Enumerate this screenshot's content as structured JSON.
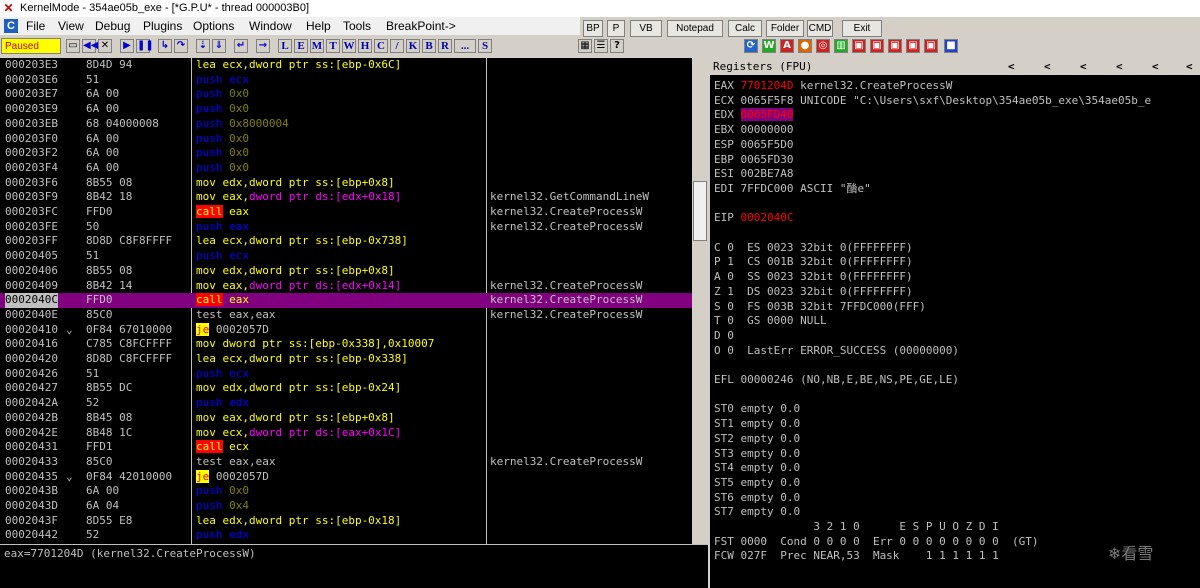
{
  "window": {
    "title": "KernelMode - 354ae05b_exe - [*G.P.U* - thread 000003B0]"
  },
  "menu": {
    "items": [
      "File",
      "View",
      "Debug",
      "Plugins",
      "Options",
      "Window",
      "Help",
      "Tools",
      "BreakPoint->"
    ]
  },
  "plugins": {
    "items": [
      "BP",
      "P",
      "VB",
      "Notepad",
      "Calc",
      "Folder",
      "CMD",
      "Exit"
    ]
  },
  "toolbar": {
    "status": "Paused",
    "letters": [
      "L",
      "E",
      "M",
      "T",
      "W",
      "H",
      "C",
      "/",
      "K",
      "B",
      "R",
      "...",
      "S"
    ]
  },
  "disasm": [
    {
      "addr": "000203E3",
      "hex": "8D4D 94",
      "asm": [
        [
          "m-lea",
          "lea ecx,dword ptr ss:[ebp-0x6C]"
        ]
      ],
      "cmt": ""
    },
    {
      "addr": "000203E6",
      "hex": "51",
      "asm": [
        [
          "m-push",
          "push ecx"
        ]
      ],
      "cmt": ""
    },
    {
      "addr": "000203E7",
      "hex": "6A 00",
      "asm": [
        [
          "m-push",
          "push "
        ],
        [
          "imm",
          "0x0"
        ]
      ],
      "cmt": ""
    },
    {
      "addr": "000203E9",
      "hex": "6A 00",
      "asm": [
        [
          "m-push",
          "push "
        ],
        [
          "imm",
          "0x0"
        ]
      ],
      "cmt": ""
    },
    {
      "addr": "000203EB",
      "hex": "68 04000008",
      "asm": [
        [
          "m-push",
          "push "
        ],
        [
          "imm",
          "0x8000004"
        ]
      ],
      "cmt": ""
    },
    {
      "addr": "000203F0",
      "hex": "6A 00",
      "asm": [
        [
          "m-push",
          "push "
        ],
        [
          "imm",
          "0x0"
        ]
      ],
      "cmt": ""
    },
    {
      "addr": "000203F2",
      "hex": "6A 00",
      "asm": [
        [
          "m-push",
          "push "
        ],
        [
          "imm",
          "0x0"
        ]
      ],
      "cmt": ""
    },
    {
      "addr": "000203F4",
      "hex": "6A 00",
      "asm": [
        [
          "m-push",
          "push "
        ],
        [
          "imm",
          "0x0"
        ]
      ],
      "cmt": ""
    },
    {
      "addr": "000203F6",
      "hex": "8B55 08",
      "asm": [
        [
          "m-mov",
          "mov edx,dword ptr ss:[ebp+0x8]"
        ]
      ],
      "cmt": ""
    },
    {
      "addr": "000203F9",
      "hex": "8B42 18",
      "asm": [
        [
          "m-mov",
          "mov eax,"
        ],
        [
          "m-mov mem",
          "dword ptr ds:[edx+0x18]"
        ]
      ],
      "cmt": "kernel32.GetCommandLineW"
    },
    {
      "addr": "000203FC",
      "hex": "FFD0",
      "asm": [
        [
          "m-call",
          "call"
        ],
        [
          "m-mov",
          " eax"
        ]
      ],
      "cmt": "kernel32.CreateProcessW"
    },
    {
      "addr": "000203FE",
      "hex": "50",
      "asm": [
        [
          "m-push",
          "push eax"
        ]
      ],
      "cmt": "kernel32.CreateProcessW"
    },
    {
      "addr": "000203FF",
      "hex": "8D8D C8F8FFFF",
      "asm": [
        [
          "m-lea",
          "lea ecx,dword ptr ss:[ebp-0x738]"
        ]
      ],
      "cmt": ""
    },
    {
      "addr": "00020405",
      "hex": "51",
      "asm": [
        [
          "m-push",
          "push ecx"
        ]
      ],
      "cmt": ""
    },
    {
      "addr": "00020406",
      "hex": "8B55 08",
      "asm": [
        [
          "m-mov",
          "mov edx,dword ptr ss:[ebp+0x8]"
        ]
      ],
      "cmt": ""
    },
    {
      "addr": "00020409",
      "hex": "8B42 14",
      "asm": [
        [
          "m-mov",
          "mov eax,"
        ],
        [
          "m-mov mem",
          "dword ptr ds:[edx+0x14]"
        ]
      ],
      "cmt": "kernel32.CreateProcessW"
    },
    {
      "addr": "0002040C",
      "hex": "FFD0",
      "asm": [
        [
          "m-call",
          "call"
        ],
        [
          "m-mov",
          " eax"
        ]
      ],
      "cmt": "kernel32.CreateProcessW",
      "sel": true
    },
    {
      "addr": "0002040E",
      "hex": "85C0",
      "asm": [
        [
          "m-test",
          "test eax,eax"
        ]
      ],
      "cmt": "kernel32.CreateProcessW"
    },
    {
      "addr": "00020410",
      "hex": "0F84 67010000",
      "asm": [
        [
          "m-je",
          "je"
        ],
        [
          "m-test",
          " 0002057D"
        ]
      ],
      "cmt": "",
      "mark": "⌄"
    },
    {
      "addr": "00020416",
      "hex": "C785 C8FCFFFF",
      "asm": [
        [
          "m-mov",
          "mov dword ptr ss:[ebp-0x338],0x10007"
        ]
      ],
      "cmt": ""
    },
    {
      "addr": "00020420",
      "hex": "8D8D C8FCFFFF",
      "asm": [
        [
          "m-lea",
          "lea ecx,dword ptr ss:[ebp-0x338]"
        ]
      ],
      "cmt": ""
    },
    {
      "addr": "00020426",
      "hex": "51",
      "asm": [
        [
          "m-push",
          "push ecx"
        ]
      ],
      "cmt": ""
    },
    {
      "addr": "00020427",
      "hex": "8B55 DC",
      "asm": [
        [
          "m-mov",
          "mov edx,dword ptr ss:[ebp-0x24]"
        ]
      ],
      "cmt": ""
    },
    {
      "addr": "0002042A",
      "hex": "52",
      "asm": [
        [
          "m-push",
          "push edx"
        ]
      ],
      "cmt": ""
    },
    {
      "addr": "0002042B",
      "hex": "8B45 08",
      "asm": [
        [
          "m-mov",
          "mov eax,dword ptr ss:[ebp+0x8]"
        ]
      ],
      "cmt": ""
    },
    {
      "addr": "0002042E",
      "hex": "8B48 1C",
      "asm": [
        [
          "m-mov",
          "mov ecx,"
        ],
        [
          "m-mov mem",
          "dword ptr ds:[eax+0x1C]"
        ]
      ],
      "cmt": ""
    },
    {
      "addr": "00020431",
      "hex": "FFD1",
      "asm": [
        [
          "m-call",
          "call"
        ],
        [
          "m-mov",
          " ecx"
        ]
      ],
      "cmt": ""
    },
    {
      "addr": "00020433",
      "hex": "85C0",
      "asm": [
        [
          "m-test",
          "test eax,eax"
        ]
      ],
      "cmt": "kernel32.CreateProcessW"
    },
    {
      "addr": "00020435",
      "hex": "0F84 42010000",
      "asm": [
        [
          "m-je",
          "je"
        ],
        [
          "m-test",
          " 0002057D"
        ]
      ],
      "cmt": "",
      "mark": "⌄"
    },
    {
      "addr": "0002043B",
      "hex": "6A 00",
      "asm": [
        [
          "m-push",
          "push "
        ],
        [
          "imm",
          "0x0"
        ]
      ],
      "cmt": ""
    },
    {
      "addr": "0002043D",
      "hex": "6A 04",
      "asm": [
        [
          "m-push",
          "push "
        ],
        [
          "imm",
          "0x4"
        ]
      ],
      "cmt": ""
    },
    {
      "addr": "0002043F",
      "hex": "8D55 E8",
      "asm": [
        [
          "m-lea",
          "lea edx,dword ptr ss:[ebp-0x18]"
        ]
      ],
      "cmt": ""
    },
    {
      "addr": "00020442",
      "hex": "52",
      "asm": [
        [
          "m-push",
          "push edx"
        ]
      ],
      "cmt": ""
    }
  ],
  "info": {
    "text": "eax=7701204D (kernel32.CreateProcessW)"
  },
  "registers": {
    "header": "Registers (FPU)",
    "lines": [
      [
        [
          "",
          "EAX "
        ],
        [
          "red",
          "7701204D"
        ],
        [
          "",
          " kernel32.CreateProcessW"
        ]
      ],
      [
        [
          "",
          "ECX 0065F5F8 UNICODE \"C:\\Users\\sxf\\Desktop\\354ae05b_exe\\354ae05b_e"
        ]
      ],
      [
        [
          "",
          "EDX "
        ],
        [
          "hl",
          "0065FD40"
        ]
      ],
      [
        [
          "",
          "EBX 00000000"
        ]
      ],
      [
        [
          "",
          "ESP 0065F5D0"
        ]
      ],
      [
        [
          "",
          "EBP 0065FD30"
        ]
      ],
      [
        [
          "",
          "ESI 002BE7A8"
        ]
      ],
      [
        [
          "",
          "EDI 7FFDC000 ASCII \"酳e\""
        ]
      ],
      [
        [
          "",
          ""
        ]
      ],
      [
        [
          "",
          "EIP "
        ],
        [
          "red",
          "0002040C"
        ]
      ],
      [
        [
          "",
          ""
        ]
      ],
      [
        [
          "",
          "C 0  ES 0023 32bit 0(FFFFFFFF)"
        ]
      ],
      [
        [
          "",
          "P 1  CS 001B 32bit 0(FFFFFFFF)"
        ]
      ],
      [
        [
          "",
          "A 0  SS 0023 32bit 0(FFFFFFFF)"
        ]
      ],
      [
        [
          "",
          "Z 1  DS 0023 32bit 0(FFFFFFFF)"
        ]
      ],
      [
        [
          "",
          "S 0  FS 003B 32bit 7FFDC000(FFF)"
        ]
      ],
      [
        [
          "",
          "T 0  GS 0000 NULL"
        ]
      ],
      [
        [
          "",
          "D 0"
        ]
      ],
      [
        [
          "",
          "O 0  LastErr ERROR_SUCCESS (00000000)"
        ]
      ],
      [
        [
          "",
          ""
        ]
      ],
      [
        [
          "",
          "EFL 00000246 (NO,NB,E,BE,NS,PE,GE,LE)"
        ]
      ],
      [
        [
          "",
          ""
        ]
      ],
      [
        [
          "",
          "ST0 empty 0.0"
        ]
      ],
      [
        [
          "",
          "ST1 empty 0.0"
        ]
      ],
      [
        [
          "",
          "ST2 empty 0.0"
        ]
      ],
      [
        [
          "",
          "ST3 empty 0.0"
        ]
      ],
      [
        [
          "",
          "ST4 empty 0.0"
        ]
      ],
      [
        [
          "",
          "ST5 empty 0.0"
        ]
      ],
      [
        [
          "",
          "ST6 empty 0.0"
        ]
      ],
      [
        [
          "",
          "ST7 empty 0.0"
        ]
      ],
      [
        [
          "",
          "               3 2 1 0      E S P U O Z D I"
        ]
      ],
      [
        [
          "",
          "FST 0000  Cond 0 0 0 0  Err 0 0 0 0 0 0 0 0  (GT)"
        ]
      ],
      [
        [
          "",
          "FCW 027F  Prec NEAR,53  Mask    1 1 1 1 1 1"
        ]
      ]
    ]
  },
  "watermark": "看雪"
}
